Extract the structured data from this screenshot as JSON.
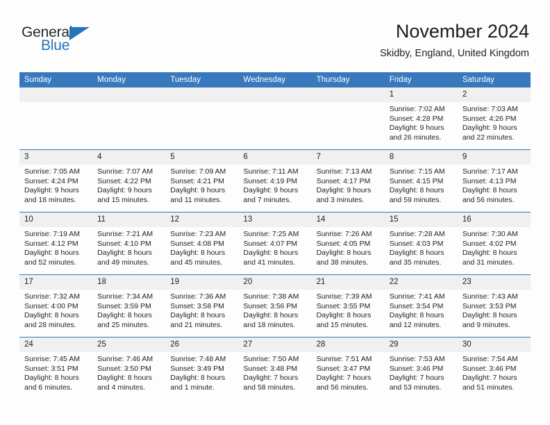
{
  "brand": {
    "name_part1": "General",
    "name_part2": "Blue",
    "accent_color": "#2573b9"
  },
  "header": {
    "title": "November 2024",
    "location": "Skidby, England, United Kingdom"
  },
  "theme": {
    "header_blue": "#3878bd",
    "daynum_band_gray": "#f0f0f0",
    "page_background": "#fdfdfd"
  },
  "weekdays": [
    "Sunday",
    "Monday",
    "Tuesday",
    "Wednesday",
    "Thursday",
    "Friday",
    "Saturday"
  ],
  "labels": {
    "sunrise_prefix": "Sunrise:",
    "sunset_prefix": "Sunset:",
    "daylight_prefix": "Daylight:"
  },
  "weeks": [
    [
      {
        "day": "",
        "empty": true
      },
      {
        "day": "",
        "empty": true
      },
      {
        "day": "",
        "empty": true
      },
      {
        "day": "",
        "empty": true
      },
      {
        "day": "",
        "empty": true
      },
      {
        "day": "1",
        "sunrise": "Sunrise: 7:02 AM",
        "sunset": "Sunset: 4:28 PM",
        "daylight_line1": "Daylight: 9 hours",
        "daylight_line2": "and 26 minutes."
      },
      {
        "day": "2",
        "sunrise": "Sunrise: 7:03 AM",
        "sunset": "Sunset: 4:26 PM",
        "daylight_line1": "Daylight: 9 hours",
        "daylight_line2": "and 22 minutes."
      }
    ],
    [
      {
        "day": "3",
        "sunrise": "Sunrise: 7:05 AM",
        "sunset": "Sunset: 4:24 PM",
        "daylight_line1": "Daylight: 9 hours",
        "daylight_line2": "and 18 minutes."
      },
      {
        "day": "4",
        "sunrise": "Sunrise: 7:07 AM",
        "sunset": "Sunset: 4:22 PM",
        "daylight_line1": "Daylight: 9 hours",
        "daylight_line2": "and 15 minutes."
      },
      {
        "day": "5",
        "sunrise": "Sunrise: 7:09 AM",
        "sunset": "Sunset: 4:21 PM",
        "daylight_line1": "Daylight: 9 hours",
        "daylight_line2": "and 11 minutes."
      },
      {
        "day": "6",
        "sunrise": "Sunrise: 7:11 AM",
        "sunset": "Sunset: 4:19 PM",
        "daylight_line1": "Daylight: 9 hours",
        "daylight_line2": "and 7 minutes."
      },
      {
        "day": "7",
        "sunrise": "Sunrise: 7:13 AM",
        "sunset": "Sunset: 4:17 PM",
        "daylight_line1": "Daylight: 9 hours",
        "daylight_line2": "and 3 minutes."
      },
      {
        "day": "8",
        "sunrise": "Sunrise: 7:15 AM",
        "sunset": "Sunset: 4:15 PM",
        "daylight_line1": "Daylight: 8 hours",
        "daylight_line2": "and 59 minutes."
      },
      {
        "day": "9",
        "sunrise": "Sunrise: 7:17 AM",
        "sunset": "Sunset: 4:13 PM",
        "daylight_line1": "Daylight: 8 hours",
        "daylight_line2": "and 56 minutes."
      }
    ],
    [
      {
        "day": "10",
        "sunrise": "Sunrise: 7:19 AM",
        "sunset": "Sunset: 4:12 PM",
        "daylight_line1": "Daylight: 8 hours",
        "daylight_line2": "and 52 minutes."
      },
      {
        "day": "11",
        "sunrise": "Sunrise: 7:21 AM",
        "sunset": "Sunset: 4:10 PM",
        "daylight_line1": "Daylight: 8 hours",
        "daylight_line2": "and 49 minutes."
      },
      {
        "day": "12",
        "sunrise": "Sunrise: 7:23 AM",
        "sunset": "Sunset: 4:08 PM",
        "daylight_line1": "Daylight: 8 hours",
        "daylight_line2": "and 45 minutes."
      },
      {
        "day": "13",
        "sunrise": "Sunrise: 7:25 AM",
        "sunset": "Sunset: 4:07 PM",
        "daylight_line1": "Daylight: 8 hours",
        "daylight_line2": "and 41 minutes."
      },
      {
        "day": "14",
        "sunrise": "Sunrise: 7:26 AM",
        "sunset": "Sunset: 4:05 PM",
        "daylight_line1": "Daylight: 8 hours",
        "daylight_line2": "and 38 minutes."
      },
      {
        "day": "15",
        "sunrise": "Sunrise: 7:28 AM",
        "sunset": "Sunset: 4:03 PM",
        "daylight_line1": "Daylight: 8 hours",
        "daylight_line2": "and 35 minutes."
      },
      {
        "day": "16",
        "sunrise": "Sunrise: 7:30 AM",
        "sunset": "Sunset: 4:02 PM",
        "daylight_line1": "Daylight: 8 hours",
        "daylight_line2": "and 31 minutes."
      }
    ],
    [
      {
        "day": "17",
        "sunrise": "Sunrise: 7:32 AM",
        "sunset": "Sunset: 4:00 PM",
        "daylight_line1": "Daylight: 8 hours",
        "daylight_line2": "and 28 minutes."
      },
      {
        "day": "18",
        "sunrise": "Sunrise: 7:34 AM",
        "sunset": "Sunset: 3:59 PM",
        "daylight_line1": "Daylight: 8 hours",
        "daylight_line2": "and 25 minutes."
      },
      {
        "day": "19",
        "sunrise": "Sunrise: 7:36 AM",
        "sunset": "Sunset: 3:58 PM",
        "daylight_line1": "Daylight: 8 hours",
        "daylight_line2": "and 21 minutes."
      },
      {
        "day": "20",
        "sunrise": "Sunrise: 7:38 AM",
        "sunset": "Sunset: 3:56 PM",
        "daylight_line1": "Daylight: 8 hours",
        "daylight_line2": "and 18 minutes."
      },
      {
        "day": "21",
        "sunrise": "Sunrise: 7:39 AM",
        "sunset": "Sunset: 3:55 PM",
        "daylight_line1": "Daylight: 8 hours",
        "daylight_line2": "and 15 minutes."
      },
      {
        "day": "22",
        "sunrise": "Sunrise: 7:41 AM",
        "sunset": "Sunset: 3:54 PM",
        "daylight_line1": "Daylight: 8 hours",
        "daylight_line2": "and 12 minutes."
      },
      {
        "day": "23",
        "sunrise": "Sunrise: 7:43 AM",
        "sunset": "Sunset: 3:53 PM",
        "daylight_line1": "Daylight: 8 hours",
        "daylight_line2": "and 9 minutes."
      }
    ],
    [
      {
        "day": "24",
        "sunrise": "Sunrise: 7:45 AM",
        "sunset": "Sunset: 3:51 PM",
        "daylight_line1": "Daylight: 8 hours",
        "daylight_line2": "and 6 minutes."
      },
      {
        "day": "25",
        "sunrise": "Sunrise: 7:46 AM",
        "sunset": "Sunset: 3:50 PM",
        "daylight_line1": "Daylight: 8 hours",
        "daylight_line2": "and 4 minutes."
      },
      {
        "day": "26",
        "sunrise": "Sunrise: 7:48 AM",
        "sunset": "Sunset: 3:49 PM",
        "daylight_line1": "Daylight: 8 hours",
        "daylight_line2": "and 1 minute."
      },
      {
        "day": "27",
        "sunrise": "Sunrise: 7:50 AM",
        "sunset": "Sunset: 3:48 PM",
        "daylight_line1": "Daylight: 7 hours",
        "daylight_line2": "and 58 minutes."
      },
      {
        "day": "28",
        "sunrise": "Sunrise: 7:51 AM",
        "sunset": "Sunset: 3:47 PM",
        "daylight_line1": "Daylight: 7 hours",
        "daylight_line2": "and 56 minutes."
      },
      {
        "day": "29",
        "sunrise": "Sunrise: 7:53 AM",
        "sunset": "Sunset: 3:46 PM",
        "daylight_line1": "Daylight: 7 hours",
        "daylight_line2": "and 53 minutes."
      },
      {
        "day": "30",
        "sunrise": "Sunrise: 7:54 AM",
        "sunset": "Sunset: 3:46 PM",
        "daylight_line1": "Daylight: 7 hours",
        "daylight_line2": "and 51 minutes."
      }
    ]
  ]
}
